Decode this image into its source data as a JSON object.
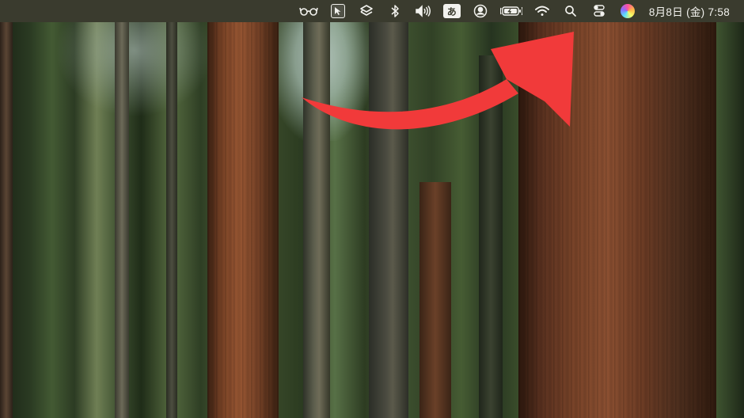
{
  "menubar": {
    "items": [
      {
        "name": "glasses-icon"
      },
      {
        "name": "cursor-select-icon"
      },
      {
        "name": "layers-icon"
      },
      {
        "name": "bluetooth-icon"
      },
      {
        "name": "volume-icon"
      },
      {
        "name": "input-method-icon",
        "label": "あ"
      },
      {
        "name": "user-icon"
      },
      {
        "name": "battery-icon"
      },
      {
        "name": "wifi-icon"
      },
      {
        "name": "search-icon"
      },
      {
        "name": "control-center-icon"
      },
      {
        "name": "siri-icon"
      }
    ],
    "clock": "8月8日 (金) 7:58"
  },
  "annotation": {
    "arrow_color": "#f13a3a"
  }
}
